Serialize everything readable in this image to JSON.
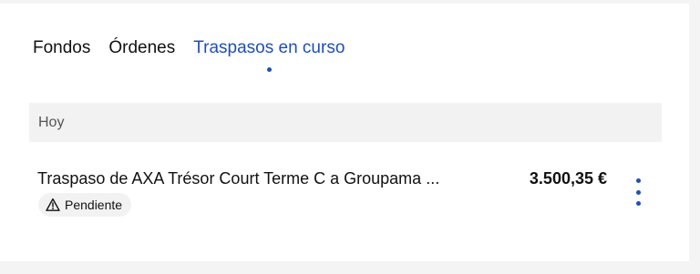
{
  "tabs": [
    {
      "label": "Fondos",
      "active": false
    },
    {
      "label": "Órdenes",
      "active": false
    },
    {
      "label": "Traspasos en curso",
      "active": true
    }
  ],
  "section": {
    "header": "Hoy"
  },
  "transfers": [
    {
      "title": "Traspaso de AXA Trésor Court Terme C a Groupama ...",
      "amount": "3.500,35 €",
      "status": "Pendiente",
      "status_icon": "warning-icon",
      "menu_icon": "more-vertical-icon"
    }
  ],
  "colors": {
    "accent": "#1f4fb5",
    "header_bg": "#f2f2f2",
    "page_bg": "#f4f4f4"
  }
}
